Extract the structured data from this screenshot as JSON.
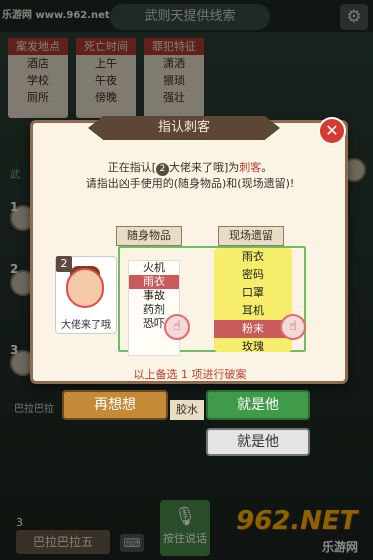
{
  "watermark": {
    "top_left": "乐游网 www.962.net",
    "badge_big": "962.NET",
    "badge_small": "乐游网"
  },
  "header": {
    "title": "武则天提供线索",
    "settings_icon": "gear-icon"
  },
  "categories": [
    {
      "title": "案发地点",
      "items": [
        "酒店",
        "学校",
        "厕所"
      ]
    },
    {
      "title": "死亡时间",
      "items": [
        "上午",
        "午夜",
        "傍晚"
      ]
    },
    {
      "title": "罪犯特征",
      "items": [
        "潇洒",
        "猥琐",
        "强壮"
      ]
    }
  ],
  "side": {
    "label_wu": "武",
    "num1": "1",
    "num2": "2",
    "num3": "3",
    "name_bottom": "巴拉巴拉"
  },
  "modal": {
    "title": "指认刺客",
    "close_icon": "close-icon",
    "instruction_prefix": "正在指认[",
    "instruction_num": "2",
    "instruction_name": "大佬来了哦",
    "instruction_mid": "]为",
    "instruction_role": "刺客",
    "instruction_end": "。",
    "instruction_line2": "请指出凶手使用的(随身物品)和(现场遗留)!",
    "tab_items": "随身物品",
    "tab_scene": "现场遗留",
    "suspect": {
      "num": "2",
      "name": "大佬来了哦"
    },
    "carried_items": [
      "火机",
      "雨衣",
      "事故",
      "药剂",
      "恐吓"
    ],
    "carried_selected": "雨衣",
    "scene_items": [
      "雨衣",
      "密码",
      "口罩",
      "耳机",
      "粉末",
      "玫瑰"
    ],
    "scene_selected": "粉末",
    "progress": "以上备选 1 项进行破案",
    "btn_rethink": "再想想",
    "btn_confirm": "就是他",
    "btn_confirm2": "就是他",
    "glue_tag": "胶水"
  },
  "bottom": {
    "num": "3",
    "name": "巴拉巴拉五",
    "keyboard_icon": "keyboard-icon",
    "voice_label": "按住说话",
    "voice_icon": "microphone-icon"
  }
}
